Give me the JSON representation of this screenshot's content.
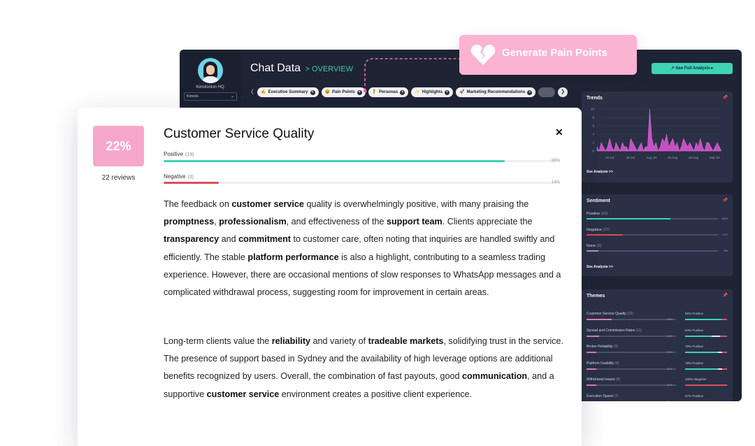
{
  "callout": {
    "label": "Generate Pain Points",
    "icon": "broken-heart-icon"
  },
  "dashboard": {
    "org_name": "Kimolonion HQ",
    "org_select": "Kimolo",
    "title": "Chat Data",
    "title_sub": "> OVERVIEW",
    "full_analysis_button": "↗ See Full Analysis ▸",
    "tabs": [
      {
        "label": "Executive Summary",
        "icon": "✍"
      },
      {
        "label": "Pain Points",
        "icon": "😫"
      },
      {
        "label": "Personas",
        "icon": "🧍"
      },
      {
        "label": "Highlights",
        "icon": "✨"
      },
      {
        "label": "Marketing Recommendations",
        "icon": "🚀"
      }
    ],
    "trends": {
      "title": "Trends",
      "y_ticks": [
        "10",
        "8",
        "6",
        "4",
        "2",
        "0"
      ],
      "x_ticks": [
        "10 Jul",
        "20 Jul",
        "Aug '24",
        "10 Aug",
        "20 Aug",
        "Sep '24"
      ],
      "see_analysis": "See Analysis >>"
    },
    "sentiment": {
      "title": "Sentiment",
      "rows": [
        {
          "label": "Positive",
          "count": "(63)",
          "pct": "64%",
          "value": 0.64,
          "color": "#3fd3b6"
        },
        {
          "label": "Negative",
          "count": "(27)",
          "pct": "27%",
          "value": 0.27,
          "color": "#d9505e"
        },
        {
          "label": "None",
          "count": "(9)",
          "pct": "9%",
          "value": 0.09,
          "color": "#9aa2b8"
        }
      ],
      "see_analysis": "See Analysis >>"
    },
    "themes": {
      "title": "Themes",
      "rows": [
        {
          "name": "Customer Service Quality",
          "count": "(22)",
          "share": "28%",
          "share_value": 0.28,
          "positive": "86% Positive",
          "pos_value": 0.86,
          "neu_value": 0.0
        },
        {
          "name": "Spread and Commission Rates",
          "count": "(11)",
          "share": "14%",
          "share_value": 0.14,
          "positive": "64% Positive",
          "pos_value": 0.64,
          "neu_value": 0.2
        },
        {
          "name": "Broker Reliability",
          "count": "(9)",
          "share": "11%",
          "share_value": 0.11,
          "positive": "78% Positive",
          "pos_value": 0.78,
          "neu_value": 0.1
        },
        {
          "name": "Platform Usability",
          "count": "(9)",
          "share": "11%",
          "share_value": 0.11,
          "positive": "78% Positive",
          "pos_value": 0.78,
          "neu_value": 0.1
        },
        {
          "name": "Withdrawal Issues",
          "count": "(9)",
          "share": "11%",
          "share_value": 0.11,
          "positive": "100% Negative",
          "pos_value": 0.0,
          "neu_value": 0.0
        },
        {
          "name": "Execution Speed",
          "count": "(7)",
          "share": "9%",
          "share_value": 0.09,
          "positive": "57% Positive",
          "pos_value": 0.57,
          "neu_value": 0.0
        }
      ]
    }
  },
  "card": {
    "badge": "22%",
    "reviews": "22 reviews",
    "title": "Customer Service Quality",
    "positive": {
      "label": "Positive",
      "count": "(19)",
      "pct": "86%",
      "value": 0.86
    },
    "negative": {
      "label": "Negative",
      "count": "(3)",
      "pct": "14%",
      "value": 0.14
    },
    "paragraph1": [
      "The feedback on ",
      "customer service",
      " quality is overwhelmingly positive, with many praising the ",
      "promptness",
      ", ",
      "professionalism",
      ", and effectiveness of the ",
      "support team",
      ". Clients appreciate the ",
      "transparency",
      " and ",
      "commitment",
      " to customer care, often noting that inquiries are handled swiftly and efficiently. The stable ",
      "platform performance",
      " is also a highlight, contributing to a seamless trading experience. However, there are occasional mentions of slow responses to WhatsApp messages and a complicated withdrawal process, suggesting room for improvement in certain areas."
    ],
    "paragraph2": [
      "Long-term clients value the ",
      "reliability",
      " and variety of ",
      "tradeable markets",
      ", solidifying trust in the service. The presence of support based in Sydney and the availability of high leverage options are additional benefits recognized by users. Overall, the combination of fast payouts, good ",
      "communication",
      ", and a supportive ",
      "customer service",
      " environment creates a positive client experience."
    ],
    "colors": {
      "positive": "#3fd3b6",
      "negative": "#d9505e",
      "badge": "#f7a7cc"
    }
  }
}
